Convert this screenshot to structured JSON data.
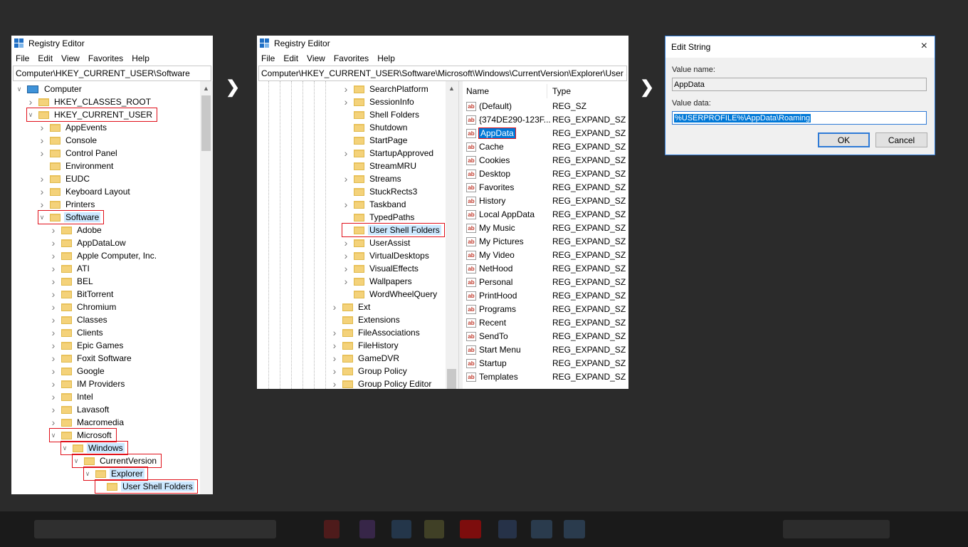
{
  "left_window": {
    "title": "Registry Editor",
    "menu": [
      "File",
      "Edit",
      "View",
      "Favorites",
      "Help"
    ],
    "address": "Computer\\HKEY_CURRENT_USER\\Software",
    "tree": [
      {
        "label": "Computer",
        "level": 0,
        "expand": "v",
        "icon": "monitor"
      },
      {
        "label": "HKEY_CLASSES_ROOT",
        "level": 1,
        "expand": ">"
      },
      {
        "label": "HKEY_CURRENT_USER",
        "level": 1,
        "expand": "v",
        "highlight": true
      },
      {
        "label": "AppEvents",
        "level": 2,
        "expand": ">"
      },
      {
        "label": "Console",
        "level": 2,
        "expand": ">"
      },
      {
        "label": "Control Panel",
        "level": 2,
        "expand": ">"
      },
      {
        "label": "Environment",
        "level": 2,
        "expand": ""
      },
      {
        "label": "EUDC",
        "level": 2,
        "expand": ">"
      },
      {
        "label": "Keyboard Layout",
        "level": 2,
        "expand": ">"
      },
      {
        "label": "Printers",
        "level": 2,
        "expand": ">"
      },
      {
        "label": "Software",
        "level": 2,
        "expand": "v",
        "highlight": true,
        "selected": true
      },
      {
        "label": "Adobe",
        "level": 3,
        "expand": ">"
      },
      {
        "label": "AppDataLow",
        "level": 3,
        "expand": ">"
      },
      {
        "label": "Apple Computer, Inc.",
        "level": 3,
        "expand": ">"
      },
      {
        "label": "ATI",
        "level": 3,
        "expand": ">"
      },
      {
        "label": "BEL",
        "level": 3,
        "expand": ">"
      },
      {
        "label": "BitTorrent",
        "level": 3,
        "expand": ">"
      },
      {
        "label": "Chromium",
        "level": 3,
        "expand": ">"
      },
      {
        "label": "Classes",
        "level": 3,
        "expand": ">"
      },
      {
        "label": "Clients",
        "level": 3,
        "expand": ">"
      },
      {
        "label": "Epic Games",
        "level": 3,
        "expand": ">"
      },
      {
        "label": "Foxit Software",
        "level": 3,
        "expand": ">"
      },
      {
        "label": "Google",
        "level": 3,
        "expand": ">"
      },
      {
        "label": "IM Providers",
        "level": 3,
        "expand": ">"
      },
      {
        "label": "Intel",
        "level": 3,
        "expand": ">"
      },
      {
        "label": "Lavasoft",
        "level": 3,
        "expand": ">"
      },
      {
        "label": "Macromedia",
        "level": 3,
        "expand": ">"
      },
      {
        "label": "Microsoft",
        "level": 3,
        "expand": "v",
        "highlight": true
      },
      {
        "label": "Windows",
        "level": 4,
        "expand": "v",
        "highlight": true,
        "selected": true
      },
      {
        "label": "CurrentVersion",
        "level": 5,
        "expand": "v",
        "highlight": true
      },
      {
        "label": "Explorer",
        "level": 6,
        "expand": "v",
        "highlight": true,
        "selected": true
      },
      {
        "label": "User Shell Folders",
        "level": 7,
        "expand": "",
        "highlight": true,
        "selected": true
      }
    ]
  },
  "mid_window": {
    "title": "Registry Editor",
    "menu": [
      "File",
      "Edit",
      "View",
      "Favorites",
      "Help"
    ],
    "address": "Computer\\HKEY_CURRENT_USER\\Software\\Microsoft\\Windows\\CurrentVersion\\Explorer\\User Shell Folders",
    "tree": [
      {
        "label": "SearchPlatform",
        "level": 1,
        "expand": ">"
      },
      {
        "label": "SessionInfo",
        "level": 1,
        "expand": ">"
      },
      {
        "label": "Shell Folders",
        "level": 1,
        "expand": ""
      },
      {
        "label": "Shutdown",
        "level": 1,
        "expand": ""
      },
      {
        "label": "StartPage",
        "level": 1,
        "expand": ""
      },
      {
        "label": "StartupApproved",
        "level": 1,
        "expand": ">"
      },
      {
        "label": "StreamMRU",
        "level": 1,
        "expand": ""
      },
      {
        "label": "Streams",
        "level": 1,
        "expand": ">"
      },
      {
        "label": "StuckRects3",
        "level": 1,
        "expand": ""
      },
      {
        "label": "Taskband",
        "level": 1,
        "expand": ">"
      },
      {
        "label": "TypedPaths",
        "level": 1,
        "expand": ""
      },
      {
        "label": "User Shell Folders",
        "level": 1,
        "expand": "",
        "highlight": true,
        "selected": true
      },
      {
        "label": "UserAssist",
        "level": 1,
        "expand": ">"
      },
      {
        "label": "VirtualDesktops",
        "level": 1,
        "expand": ">"
      },
      {
        "label": "VisualEffects",
        "level": 1,
        "expand": ">"
      },
      {
        "label": "Wallpapers",
        "level": 1,
        "expand": ">"
      },
      {
        "label": "WordWheelQuery",
        "level": 1,
        "expand": ""
      },
      {
        "label": "Ext",
        "level": 0,
        "expand": ">"
      },
      {
        "label": "Extensions",
        "level": 0,
        "expand": ""
      },
      {
        "label": "FileAssociations",
        "level": 0,
        "expand": ">"
      },
      {
        "label": "FileHistory",
        "level": 0,
        "expand": ">"
      },
      {
        "label": "GameDVR",
        "level": 0,
        "expand": ">"
      },
      {
        "label": "Group Policy",
        "level": 0,
        "expand": ">"
      },
      {
        "label": "Group Policy Editor",
        "level": 0,
        "expand": ">"
      }
    ],
    "list_headers": {
      "name": "Name",
      "type": "Type"
    },
    "values": [
      {
        "name": "(Default)",
        "type": "REG_SZ"
      },
      {
        "name": "{374DE290-123F...",
        "type": "REG_EXPAND_SZ"
      },
      {
        "name": "AppData",
        "type": "REG_EXPAND_SZ",
        "selected": true
      },
      {
        "name": "Cache",
        "type": "REG_EXPAND_SZ"
      },
      {
        "name": "Cookies",
        "type": "REG_EXPAND_SZ"
      },
      {
        "name": "Desktop",
        "type": "REG_EXPAND_SZ"
      },
      {
        "name": "Favorites",
        "type": "REG_EXPAND_SZ"
      },
      {
        "name": "History",
        "type": "REG_EXPAND_SZ"
      },
      {
        "name": "Local AppData",
        "type": "REG_EXPAND_SZ"
      },
      {
        "name": "My Music",
        "type": "REG_EXPAND_SZ"
      },
      {
        "name": "My Pictures",
        "type": "REG_EXPAND_SZ"
      },
      {
        "name": "My Video",
        "type": "REG_EXPAND_SZ"
      },
      {
        "name": "NetHood",
        "type": "REG_EXPAND_SZ"
      },
      {
        "name": "Personal",
        "type": "REG_EXPAND_SZ"
      },
      {
        "name": "PrintHood",
        "type": "REG_EXPAND_SZ"
      },
      {
        "name": "Programs",
        "type": "REG_EXPAND_SZ"
      },
      {
        "name": "Recent",
        "type": "REG_EXPAND_SZ"
      },
      {
        "name": "SendTo",
        "type": "REG_EXPAND_SZ"
      },
      {
        "name": "Start Menu",
        "type": "REG_EXPAND_SZ"
      },
      {
        "name": "Startup",
        "type": "REG_EXPAND_SZ"
      },
      {
        "name": "Templates",
        "type": "REG_EXPAND_SZ"
      }
    ]
  },
  "dialog": {
    "title": "Edit String",
    "value_name_label": "Value name:",
    "value_name": "AppData",
    "value_data_label": "Value data:",
    "value_data": "%USERPROFILE%\\AppData\\Roaming",
    "ok_label": "OK",
    "cancel_label": "Cancel"
  },
  "icons": {
    "step_arrow": "chevron-right-icon",
    "string_value": "ab",
    "close": "×"
  },
  "colors": {
    "highlight_border": "#e0101a",
    "selection": "#cce8ff",
    "value_selection": "#0078d7",
    "folder": "#f4d27a"
  }
}
